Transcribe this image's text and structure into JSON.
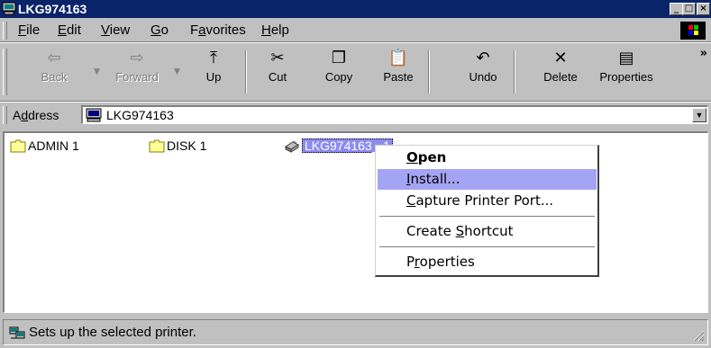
{
  "window": {
    "title": "LKG974163",
    "controls": {
      "minimize": "_",
      "maximize": "□",
      "close": "×"
    }
  },
  "menubar": {
    "items": [
      {
        "label": "File",
        "accel": "F",
        "rest": "ile"
      },
      {
        "label": "Edit",
        "accel": "E",
        "rest": "dit"
      },
      {
        "label": "View",
        "accel": "V",
        "rest": "iew"
      },
      {
        "label": "Go",
        "accel": "G",
        "rest": "o"
      },
      {
        "label": "Favorites",
        "pre": "F",
        "accel": "a",
        "rest": "vorites"
      },
      {
        "label": "Help",
        "accel": "H",
        "rest": "elp"
      }
    ]
  },
  "toolbar": {
    "back": {
      "label": "Back",
      "icon": "⇦"
    },
    "forward": {
      "label": "Forward",
      "icon": "⇨"
    },
    "up": {
      "label": "Up",
      "icon": "⤒"
    },
    "cut": {
      "label": "Cut",
      "icon": "✂"
    },
    "copy": {
      "label": "Copy",
      "icon": "❐"
    },
    "paste": {
      "label": "Paste",
      "icon": "📋"
    },
    "undo": {
      "label": "Undo",
      "icon": "↶"
    },
    "delete": {
      "label": "Delete",
      "icon": "✕"
    },
    "properties": {
      "label": "Properties",
      "icon": "▤"
    },
    "more": "»"
  },
  "address": {
    "label_pre": "A",
    "label_accel": "d",
    "label_rest": "dress",
    "value": "LKG974163"
  },
  "content": {
    "items": [
      {
        "name": "ADMIN 1",
        "type": "folder"
      },
      {
        "name": "DISK 1",
        "type": "folder"
      },
      {
        "name": "LKG974163_-1",
        "type": "printer",
        "selected": true
      }
    ]
  },
  "context_menu": {
    "open": {
      "accel": "O",
      "rest": "pen"
    },
    "install": {
      "accel": "I",
      "rest": "nstall..."
    },
    "capture": {
      "accel": "C",
      "rest": "apture Printer Port..."
    },
    "shortcut": {
      "pre": "Create ",
      "accel": "S",
      "rest": "hortcut"
    },
    "properties": {
      "pre": "P",
      "accel": "r",
      "rest": "operties"
    }
  },
  "status": {
    "text": "Sets up the selected printer."
  },
  "colors": {
    "titlebar": "#0a246a",
    "selection": "#8c8cf0",
    "menu_highlight": "#a4a4f4",
    "face": "#c0c0c0"
  }
}
